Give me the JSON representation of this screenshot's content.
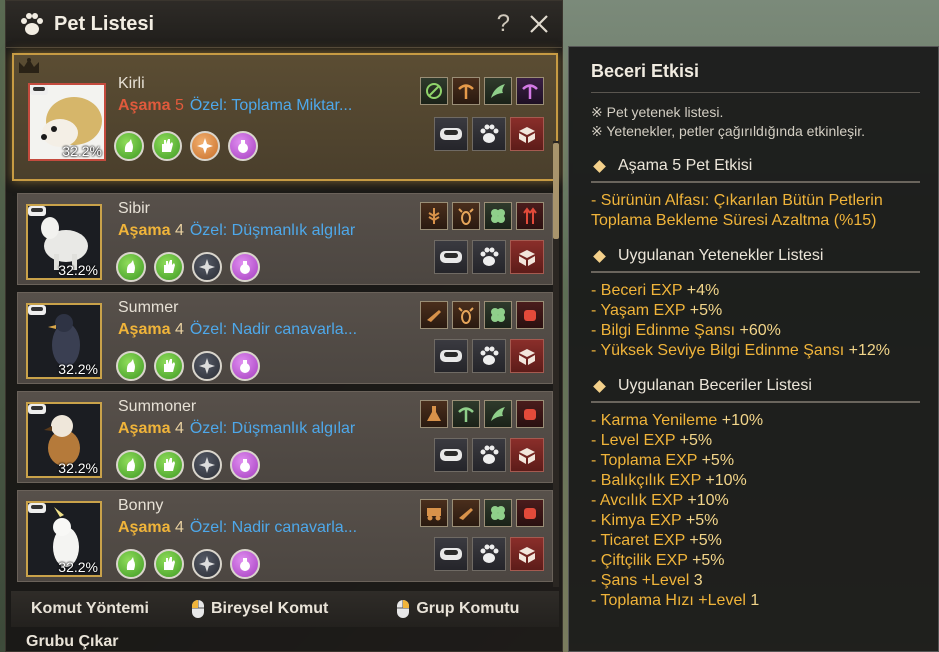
{
  "window": {
    "title": "Pet Listesi",
    "help": "?"
  },
  "pets": [
    {
      "name": "Kirli",
      "stage_label": "Aşama",
      "stage": "5",
      "special": "Özel: Toplama Miktar...",
      "percent": "32.2%",
      "active": true,
      "skills": [
        "green",
        "green",
        "orange",
        "purple"
      ]
    },
    {
      "name": "Sibir",
      "stage_label": "Aşama",
      "stage": "4",
      "special": "Özel: Düşmanlık algılar",
      "percent": "32.2%",
      "active": false,
      "skills": [
        "green",
        "green",
        "gray",
        "purple"
      ]
    },
    {
      "name": "Summer",
      "stage_label": "Aşama",
      "stage": "4",
      "special": "Özel: Nadir canavarla...",
      "percent": "32.2%",
      "active": false,
      "skills": [
        "green",
        "green",
        "gray",
        "purple"
      ]
    },
    {
      "name": "Summoner",
      "stage_label": "Aşama",
      "stage": "4",
      "special": "Özel: Düşmanlık algılar",
      "percent": "32.2%",
      "active": false,
      "skills": [
        "green",
        "green",
        "gray",
        "purple"
      ]
    },
    {
      "name": "Bonny",
      "stage_label": "Aşama",
      "stage": "4",
      "special": "Özel: Nadir canavarla...",
      "percent": "32.2%",
      "active": false,
      "skills": [
        "green",
        "green",
        "gray",
        "purple"
      ]
    }
  ],
  "bottom": {
    "command_method": "Komut Yöntemi",
    "individual_command": "Bireysel Komut",
    "group_command": "Grup Komutu",
    "remove_group": "Grubu Çıkar"
  },
  "effect_panel": {
    "title": "Beceri Etkisi",
    "notes": [
      "※ Pet yetenek listesi.",
      "※ Yetenekler, petler çağırıldığında etkinleşir."
    ],
    "stage_section": {
      "label": "Aşama",
      "stage": "5",
      "suffix": "Pet Etkisi"
    },
    "stage_effect_1": "- Sürünün Alfası: Çıkarılan Bütün Petlerin",
    "stage_effect_2": "Toplama Bekleme Süresi Azaltma (%15)",
    "applied_talents_title": "Uygulanan Yetenekler Listesi",
    "talents": [
      {
        "text": "- Beceri EXP ",
        "val": "+4%"
      },
      {
        "text": "- Yaşam EXP ",
        "val": "+5%"
      },
      {
        "text": "- Bilgi Edinme Şansı ",
        "val": "+60%"
      },
      {
        "text": "- Yüksek Seviye Bilgi Edinme Şansı ",
        "val": "+12%"
      }
    ],
    "applied_skills_title": "Uygulanan Beceriler Listesi",
    "skills": [
      {
        "text": "- Karma Yenileme ",
        "val": "+10%"
      },
      {
        "text": "- Level EXP ",
        "val": "+5%"
      },
      {
        "text": "- Toplama EXP ",
        "val": "+5%"
      },
      {
        "text": "- Balıkçılık EXP ",
        "val": "+10%"
      },
      {
        "text": "- Avcılık EXP ",
        "val": "+10%"
      },
      {
        "text": "- Kimya EXP ",
        "val": "+5%"
      },
      {
        "text": "- Ticaret EXP ",
        "val": "+5%"
      },
      {
        "text": "- Çiftçilik EXP ",
        "val": "+5%"
      },
      {
        "text": "- Şans +Level ",
        "val": "3"
      },
      {
        "text": "- Toplama Hızı +Level ",
        "val": "1"
      }
    ]
  },
  "colors": {
    "accent_gold": "#f0b43a",
    "special_blue": "#4ea8ea",
    "active_red": "#e05a3c"
  }
}
